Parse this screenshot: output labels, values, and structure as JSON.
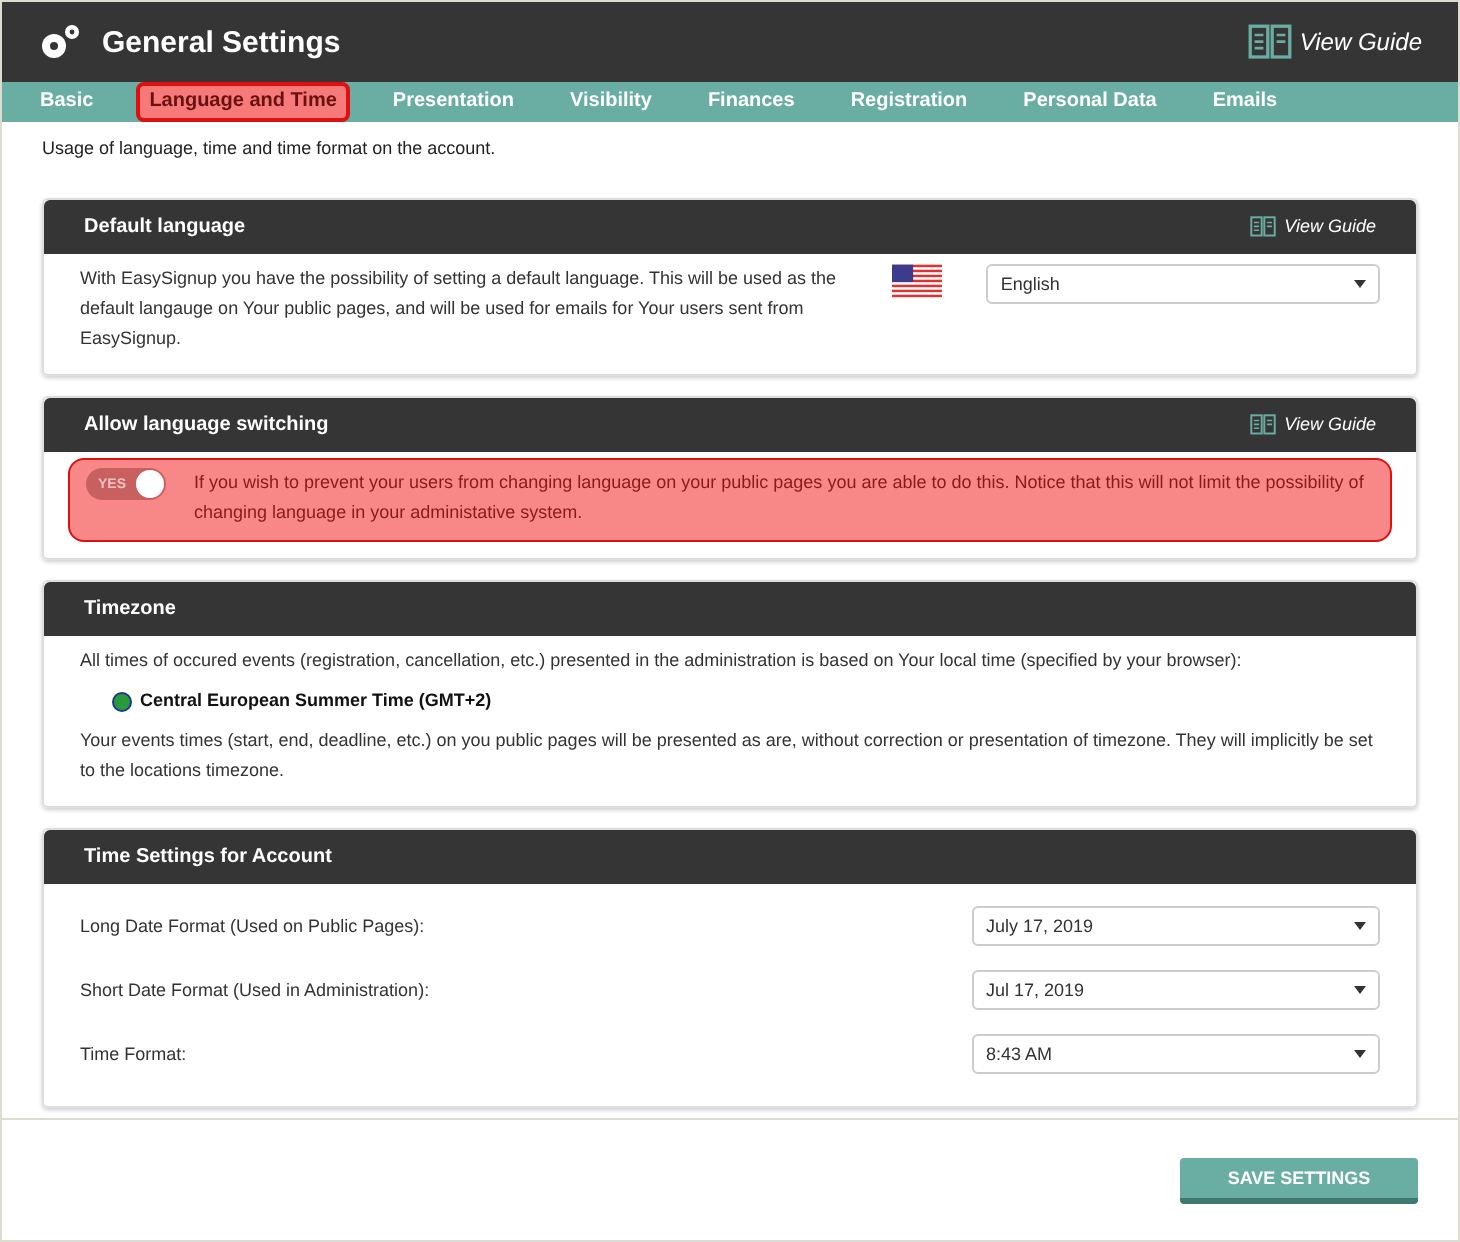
{
  "window": {
    "title": "General Settings",
    "guide_link": "View Guide"
  },
  "tabs": [
    {
      "label": "Basic",
      "selected": false
    },
    {
      "label": "Language and Time",
      "selected": true
    },
    {
      "label": "Presentation",
      "selected": false
    },
    {
      "label": "Visibility",
      "selected": false
    },
    {
      "label": "Finances",
      "selected": false
    },
    {
      "label": "Registration",
      "selected": false
    },
    {
      "label": "Personal Data",
      "selected": false
    },
    {
      "label": "Emails",
      "selected": false
    }
  ],
  "description": "Usage of language, time and time format on the account.",
  "sections": [
    {
      "kind": "language",
      "title": "Default language",
      "guide_link": "View Guide",
      "text": "With EasySignup you have the possibility of setting a default language. This will be used as the default langauge on Your public pages, and will be used for emails for Your users sent from EasySignup.",
      "select": "English"
    },
    {
      "kind": "switch",
      "title": "Allow language switching",
      "guide_link": "View Guide",
      "highlighted": true,
      "toggle": {
        "label": "YES",
        "on": true
      },
      "text": "If you wish to prevent your users from changing language on your public pages you are able to do this. Notice that this will not limit the possibility of changing language in your administative system."
    },
    {
      "kind": "timezone",
      "title": "Timezone",
      "text": "All times of occured events (registration, cancellation, etc.) presented in the administration is based on Your local time (specified by your browser):",
      "zone": "Central European Summer Time (GMT+2)",
      "note": "Your events times (start, end, deadline, etc.) on you public pages will be presented as are, without correction or presentation of timezone. They will implicitly be set to the locations timezone."
    },
    {
      "kind": "form",
      "title": "Time Settings for Account",
      "rows": [
        {
          "label": "Long Date Format (Used on Public Pages):",
          "value": "July 17, 2019"
        },
        {
          "label": "Short Date Format (Used in Administration):",
          "value": "Jul 17, 2019"
        },
        {
          "label": "Time Format:",
          "value": "8:43 AM"
        }
      ]
    }
  ],
  "save_button": "SAVE SETTINGS"
}
